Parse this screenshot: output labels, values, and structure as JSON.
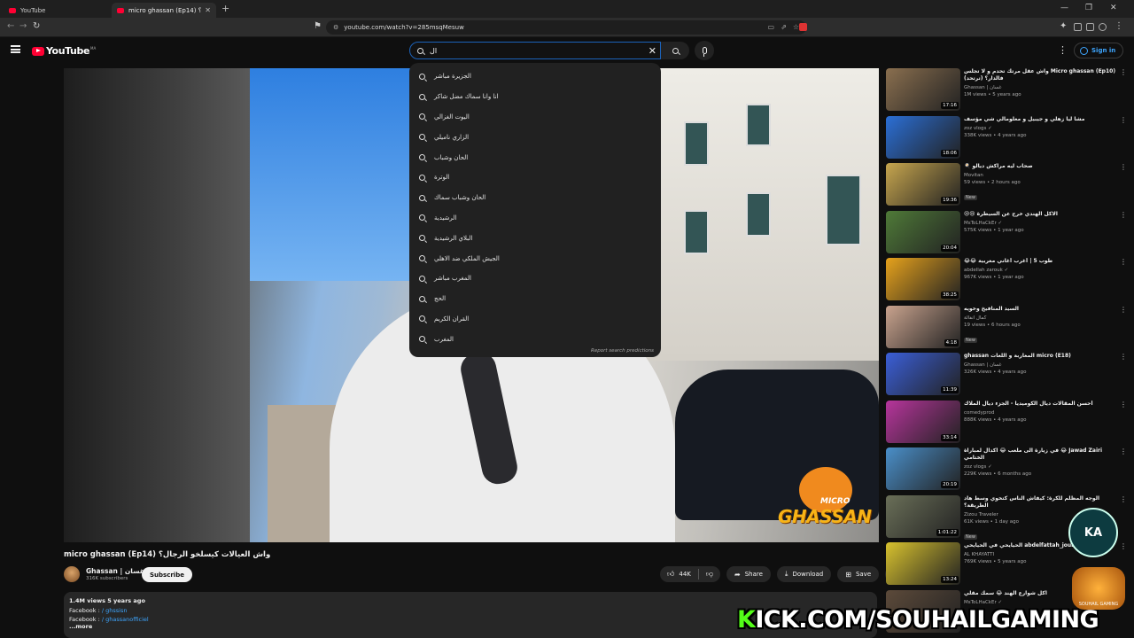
{
  "browser": {
    "tabs": [
      {
        "title": "YouTube"
      },
      {
        "title": "micro ghassan (Ep14) واش العيالات كيسلخو الرجال؟"
      }
    ],
    "url": "youtube.com/watch?v=285msqMesuw"
  },
  "masthead": {
    "logo_text": "YouTube",
    "logo_country": "MA",
    "search_query": "ال",
    "signin_label": "Sign in"
  },
  "suggestions": [
    "الجزيرة مباشر",
    "انا وانا سماك مضل شاكر",
    "اليوت الغزالي",
    "الزاري ناميلي",
    "الحان وشباب",
    "الوترة",
    "الحان وشباب سماك",
    "الرشيدية",
    "البلاي الرشيدية",
    "الجيش الملكي ضد الاهلي",
    "المغرب مباشر",
    "الحج",
    "القران الكريم",
    "المغرب"
  ],
  "report_label": "Report search predictions",
  "video": {
    "title": "micro ghassan (Ep14) واش العيالات كيسلخو الرجال؟",
    "channel": "Ghassan | غسان",
    "subscribers": "316K subscribers",
    "subscribe_label": "Subscribe",
    "likes": "44K",
    "share_label": "Share",
    "download_label": "Download",
    "save_label": "Save",
    "watermark_top": "MICRO",
    "watermark_bottom": "GHASSAN"
  },
  "description": {
    "meta": "1.4M views  5 years ago",
    "line1_label": "Facebook : ",
    "line1_link": "/ ghssisn",
    "line2_label": "Facebook : ",
    "line2_link": "/ ghassanofficiel",
    "more": "...more"
  },
  "recommendations": [
    {
      "title": "Micro ghassan (Ep10) واش عقل مرتك تحدم و لا تجلس فالدار؟ (ترتحد)",
      "channel": "Ghassan | غسان",
      "meta": "1M views • 5 years ago",
      "duration": "17:16",
      "new": "",
      "color": "#8a6f4f"
    },
    {
      "title": "مشا ليا زهلي و جيبيل و معلومالي شي مؤسف",
      "channel": "zoz vlogs ✓",
      "meta": "338K views • 4 years ago",
      "duration": "18:06",
      "new": "",
      "color": "#2b6fd6"
    },
    {
      "title": "صحاب ليه مراكش ديالو 🍳",
      "channel": "Movitan",
      "meta": "59 views • 2 hours ago",
      "duration": "19:36",
      "new": "New",
      "color": "#c7a64e"
    },
    {
      "title": "الاكل الهندي خرج عن السيطرة 😢😢",
      "channel": "MsToLHaCkEr ✓",
      "meta": "575K views • 1 year ago",
      "duration": "20:04",
      "new": "",
      "color": "#4f7a38"
    },
    {
      "title": "طوب 5 | أغرب أغاني مغربية 😂😂",
      "channel": "abdellah zarouk ✓",
      "meta": "967K views • 1 year ago",
      "duration": "38:25",
      "new": "",
      "color": "#e6a21c"
    },
    {
      "title": "السيد المنافيخ وخويه",
      "channel": "كمال انفالة",
      "meta": "19 views • 6 hours ago",
      "duration": "4:18",
      "new": "New",
      "color": "#c9a38e"
    },
    {
      "title": "micro (E18) المغاربة و اللغات ghassan",
      "channel": "Ghassan | غسان",
      "meta": "326K views • 4 years ago",
      "duration": "11:39",
      "new": "",
      "color": "#3b5fd8"
    },
    {
      "title": "أحسن المقالات ديال الكوميديا - الجزء ديال الملاك",
      "channel": "comedyprod",
      "meta": "888K views • 4 years ago",
      "duration": "33:14",
      "new": "",
      "color": "#b7359c"
    },
    {
      "title": "Jawad Zairi 😂 في زيارة الى ملعب 😂 اكدال لمباراة الختامي",
      "channel": "zoz vlogs ✓",
      "meta": "229K views • 6 months ago",
      "duration": "20:19",
      "new": "",
      "color": "#4a8fc9"
    },
    {
      "title": "الوجه المظلم للكرة: كيفاش الناس كتخوي وسط هاد الطريقة؟",
      "channel": "Zizou Traveler",
      "meta": "61K views • 1 day ago",
      "duration": "1:01:22",
      "new": "New",
      "color": "#6a6f58"
    },
    {
      "title": "#abdelfattah_jouadi الحيايحي في الحيايحي",
      "channel": "AL KHAYATTI",
      "meta": "769K views • 5 years ago",
      "duration": "13:24",
      "new": "",
      "color": "#d8c22e"
    },
    {
      "title": "اكل شوارع الهند 😂 سمك مقلي",
      "channel": "MsToLHaCkEr ✓",
      "meta": "",
      "duration": "",
      "new": "",
      "color": "#5c4a3a"
    }
  ],
  "overlay": {
    "kick_first": "K",
    "kick_rest": "ICK.COM/SOUHAILGAMING",
    "badge_k": "KA",
    "badge_sg": "SOUHAIL GAMING"
  }
}
